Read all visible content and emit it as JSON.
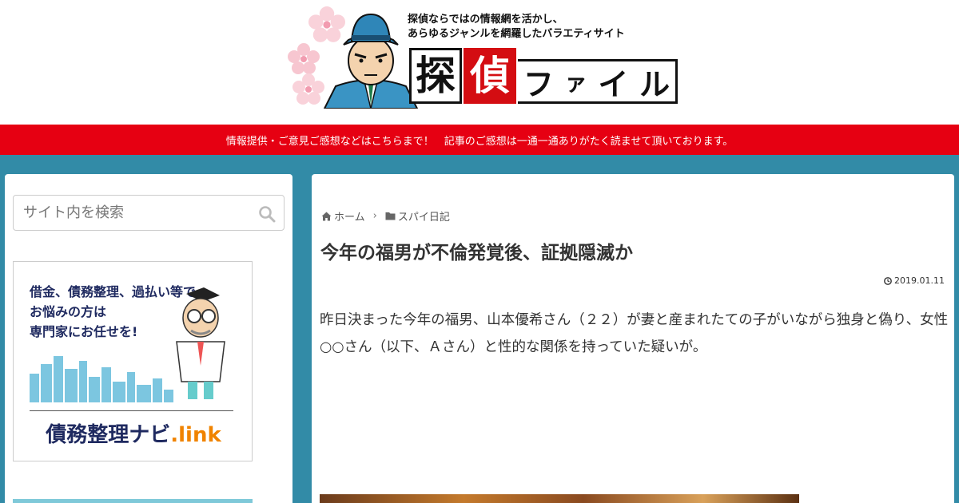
{
  "header": {
    "tagline_line1": "探偵ならではの情報網を活かし、",
    "tagline_line2": "あらゆるジャンルを網羅したバラエティサイト",
    "logo_kanji1": "探",
    "logo_kanji2": "偵",
    "logo_kana": [
      "フ",
      "ァ",
      "イ",
      "ル"
    ]
  },
  "notice": {
    "text": "情報提供・ご意見ご感想などはこちらまで！　記事のご感想は一通一通ありがたく読ませて頂いております。"
  },
  "sidebar": {
    "search": {
      "placeholder": "サイト内を検索"
    },
    "ad": {
      "line1": "借金、債務整理、過払い等で",
      "line2": "お悩みの方は",
      "line3": "専門家にお任せを!",
      "brand_main": "債務整理ナビ",
      "brand_suffix": ".link"
    }
  },
  "breadcrumb": {
    "home": "ホーム",
    "category": "スパイ日記"
  },
  "article": {
    "title": "今年の福男が不倫発覚後、証拠隠滅か",
    "date": "2019.01.11",
    "body": "昨日決まった今年の福男、山本優希さん（２２）が妻と産まれたての子がいながら独身と偽り、女性○○さん（以下、Ａさん）と性的な関係を持っていた疑いが。"
  },
  "colors": {
    "background": "#328ba7",
    "notice_bar": "#e60012",
    "logo_red": "#d40d12"
  }
}
